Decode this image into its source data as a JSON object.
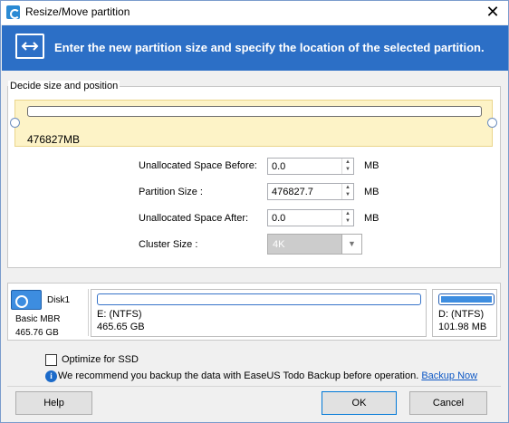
{
  "window": {
    "title": "Resize/Move partition",
    "close_glyph": "✕"
  },
  "banner": {
    "text": "Enter the new partition size and specify the location of the selected partition.",
    "icon": "resize-arrows-icon"
  },
  "size_group": {
    "title": "Decide size and position",
    "slider_size": "476827MB",
    "fields": {
      "before_label": "Unallocated Space Before:",
      "before_value": "0.0",
      "size_label": "Partition Size :",
      "size_value": "476827.7",
      "after_label": "Unallocated Space After:",
      "after_value": "0.0",
      "unit": "MB",
      "cluster_label": "Cluster Size :",
      "cluster_value": "4K"
    }
  },
  "disk": {
    "name": "Disk1",
    "type": "Basic MBR",
    "capacity": "465.76 GB",
    "partitions": [
      {
        "label": "E: (NTFS)",
        "size": "465.65 GB"
      },
      {
        "label": "D: (NTFS)",
        "size": "101.98 MB"
      }
    ]
  },
  "options": {
    "optimize_ssd": "Optimize for SSD",
    "optimize_ssd_checked": false,
    "info": "We recommend you backup the data with EaseUS Todo Backup before operation.",
    "info_link": "Backup Now"
  },
  "buttons": {
    "help": "Help",
    "ok": "OK",
    "cancel": "Cancel"
  },
  "colors": {
    "banner": "#2c6fc6",
    "slider_bg": "#fdf3c7",
    "link": "#0e58c5"
  }
}
